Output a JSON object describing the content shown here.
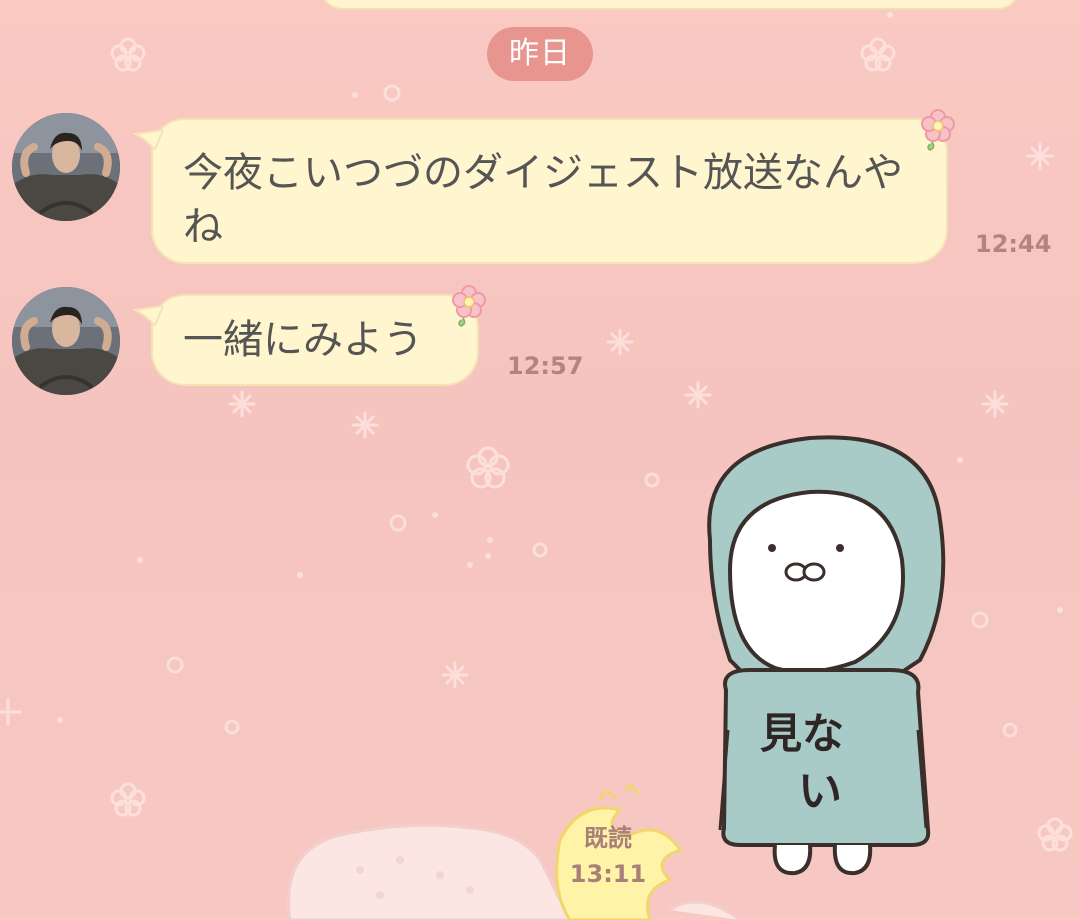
{
  "date_divider": "昨日",
  "messages": [
    {
      "text": "今夜こいつづのダイジェスト放送なんやね",
      "time": "12:44"
    },
    {
      "text": "一緒にみよう",
      "time": "12:57"
    }
  ],
  "outgoing_sticker": {
    "hood_text_line1": "見な",
    "hood_text_line2": "い",
    "read_label": "既読",
    "time": "13:11"
  },
  "colors": {
    "background": "#f7c6c1",
    "bubble": "#fff6cf",
    "date_pill": "#e8948f",
    "time_text": "#b5837d",
    "hoodie": "#a9cbc7"
  }
}
